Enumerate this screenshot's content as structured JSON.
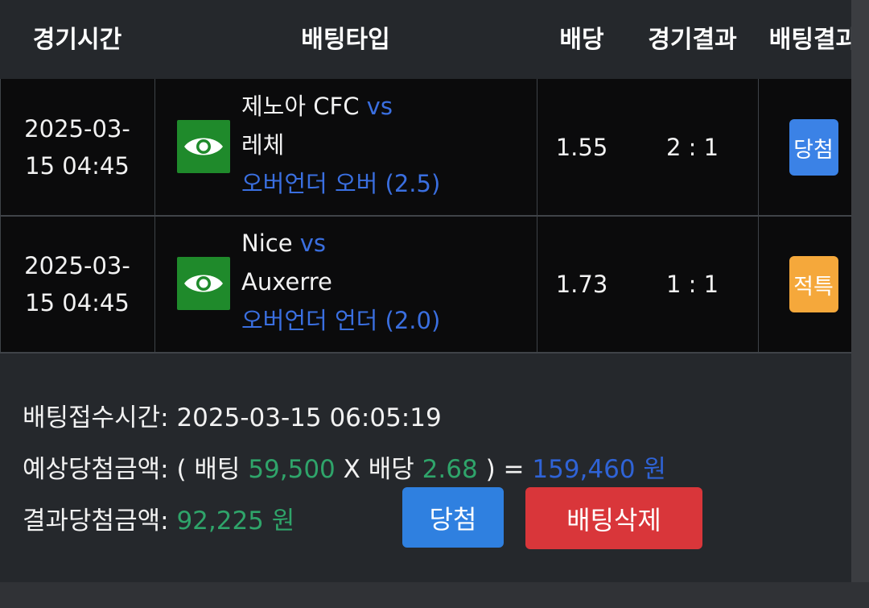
{
  "header": {
    "time": "경기시간",
    "bet_type": "배팅타입",
    "odds": "배당",
    "match_result": "경기결과",
    "bet_result": "배팅결과"
  },
  "rows": [
    {
      "time": "2025-03-15 04:45",
      "home": "제노아 CFC",
      "vs": "vs",
      "away": "레체",
      "market": "오버언더 오버 (2.5)",
      "odds": "1.55",
      "score": "2 : 1",
      "result": "당첨",
      "result_color": "#3b82e6",
      "icon": "eye-icon"
    },
    {
      "time": "2025-03-15 04:45",
      "home": "Nice",
      "vs": "vs",
      "away": "Auxerre",
      "market": "오버언더 언더 (2.0)",
      "odds": "1.73",
      "score": "1 : 1",
      "result": "적특",
      "result_color": "#f5a83b",
      "icon": "eye-icon"
    }
  ],
  "summary": {
    "bet_time_label": "배팅접수시간:",
    "bet_time": "2025-03-15 06:05:19",
    "expected_label": "예상당첨금액:",
    "open_paren": "(",
    "bet_word": "배팅",
    "bet_amount": "59,500",
    "times": "X",
    "odds_word": "배당",
    "total_odds": "2.68",
    "close_eq": ") =",
    "expected_amount": "159,460 원",
    "result_label": "결과당첨금액:",
    "result_amount": "92,225 원"
  },
  "buttons": {
    "win": "당첨",
    "delete": "배팅삭제"
  },
  "colors": {
    "win_button": "#2f80e0",
    "delete_button": "#d9363a",
    "eye_icon_bg": "#1f8a2b",
    "accent_green": "#2fa46a",
    "accent_blue": "#2f63d6"
  }
}
